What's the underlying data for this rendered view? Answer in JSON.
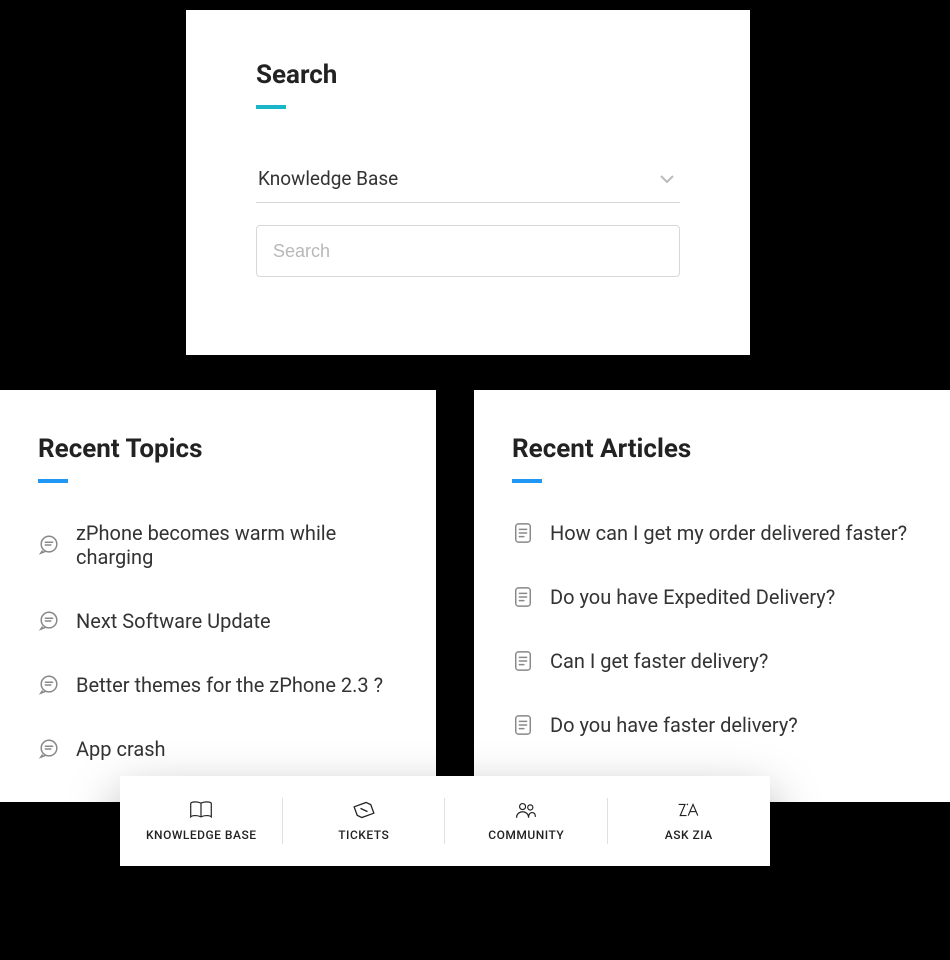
{
  "search": {
    "title": "Search",
    "scope_label": "Knowledge Base",
    "placeholder": "Search"
  },
  "topics": {
    "title": "Recent Topics",
    "items": [
      "zPhone becomes warm while charging",
      "Next Software Update",
      "Better themes for the zPhone 2.3 ?",
      "App crash"
    ]
  },
  "articles": {
    "title": "Recent Articles",
    "items": [
      "How can I get my order delivered faster?",
      "Do you have Expedited Delivery?",
      "Can I get faster delivery?",
      "Do you have faster delivery?"
    ]
  },
  "nav": {
    "items": [
      {
        "label": "KNOWLEDGE BASE"
      },
      {
        "label": "TICKETS"
      },
      {
        "label": "COMMUNITY"
      },
      {
        "label": "ASK ZIA"
      }
    ]
  }
}
